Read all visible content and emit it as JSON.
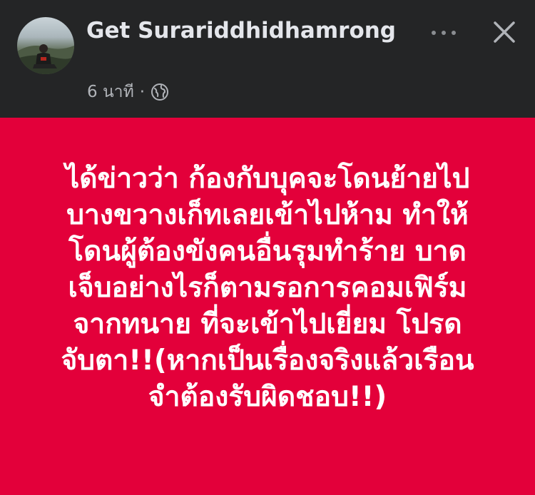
{
  "author": {
    "name": "Get Surariddhidhamrong",
    "time": "6 นาที",
    "separator": "·",
    "audience_icon": "globe-icon"
  },
  "header_actions": {
    "more_icon": "more-horizontal-icon",
    "close_icon": "close-icon"
  },
  "post": {
    "background_color": "#e3003a",
    "text": "ได้ข่าวว่า ก้องกับบุคจะโดนย้ายไป\nบางขวางเก็ทเลยเข้าไปห้าม ทำให้\nโดนผู้ต้องขังคนอื่นรุมทำร้าย บาด\nเจ็บอย่างไรก็ตามรอการคอมเฟิร์ม\nจากทนาย ที่จะเข้าไปเยี่ยม โปรด\nจับตา!!(หากเป็นเรื่องจริงแล้วเรือน\nจำต้องรับผิดชอบ!!)"
  }
}
